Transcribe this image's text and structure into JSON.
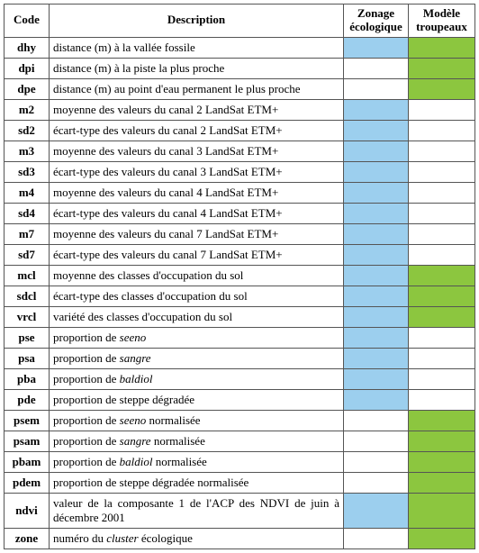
{
  "headers": {
    "code": "Code",
    "description": "Description",
    "zonage": "Zonage écologique",
    "modele": "Modèle troupeaux"
  },
  "rows": [
    {
      "code": "dhy",
      "desc": "distance (m) à la vallée fossile",
      "zon": true,
      "mod": true
    },
    {
      "code": "dpi",
      "desc": "distance (m) à la piste la plus proche",
      "zon": false,
      "mod": true
    },
    {
      "code": "dpe",
      "desc": "distance (m) au point d'eau permanent le plus proche",
      "zon": false,
      "mod": true
    },
    {
      "code": "m2",
      "desc": "moyenne des valeurs du canal 2 LandSat ETM+",
      "zon": true,
      "mod": false
    },
    {
      "code": "sd2",
      "desc": "écart-type des valeurs du canal 2 LandSat ETM+",
      "zon": true,
      "mod": false
    },
    {
      "code": "m3",
      "desc": "moyenne des valeurs du canal 3 LandSat ETM+",
      "zon": true,
      "mod": false
    },
    {
      "code": "sd3",
      "desc": "écart-type des valeurs du canal 3 LandSat ETM+",
      "zon": true,
      "mod": false
    },
    {
      "code": "m4",
      "desc": "moyenne des valeurs du canal 4 LandSat ETM+",
      "zon": true,
      "mod": false
    },
    {
      "code": "sd4",
      "desc": "écart-type des valeurs du canal 4 LandSat ETM+",
      "zon": true,
      "mod": false
    },
    {
      "code": "m7",
      "desc": "moyenne des valeurs du canal 7 LandSat ETM+",
      "zon": true,
      "mod": false
    },
    {
      "code": "sd7",
      "desc": "écart-type des valeurs du canal 7 LandSat ETM+",
      "zon": true,
      "mod": false
    },
    {
      "code": "mcl",
      "desc": "moyenne des classes d'occupation du sol",
      "zon": true,
      "mod": true
    },
    {
      "code": "sdcl",
      "desc": "écart-type des classes d'occupation du sol",
      "zon": true,
      "mod": true
    },
    {
      "code": "vrcl",
      "desc": "variété des classes d'occupation du sol",
      "zon": true,
      "mod": true
    },
    {
      "code": "pse",
      "desc_html": "proportion de <em class='it'>seeno</em>",
      "zon": true,
      "mod": false
    },
    {
      "code": "psa",
      "desc_html": "proportion de <em class='it'>sangre</em>",
      "zon": true,
      "mod": false
    },
    {
      "code": "pba",
      "desc_html": "proportion de <em class='it'>baldiol</em>",
      "zon": true,
      "mod": false
    },
    {
      "code": "pde",
      "desc": "proportion de steppe dégradée",
      "zon": true,
      "mod": false
    },
    {
      "code": "psem",
      "desc_html": "proportion de <em class='it'>seeno</em> normalisée",
      "zon": false,
      "mod": true
    },
    {
      "code": "psam",
      "desc_html": "proportion de <em class='it'>sangre</em> normalisée",
      "zon": false,
      "mod": true
    },
    {
      "code": "pbam",
      "desc_html": "proportion de <em class='it'>baldiol</em> normalisée",
      "zon": false,
      "mod": true
    },
    {
      "code": "pdem",
      "desc": "proportion de steppe dégradée normalisée",
      "zon": false,
      "mod": true
    },
    {
      "code": "ndvi",
      "desc": "valeur de la composante 1 de l'ACP des NDVI de juin à décembre 2001",
      "justify": true,
      "zon": true,
      "mod": true
    },
    {
      "code": "zone",
      "desc_html": "numéro du <em class='it'>cluster</em> écologique",
      "zon": false,
      "mod": true
    }
  ]
}
